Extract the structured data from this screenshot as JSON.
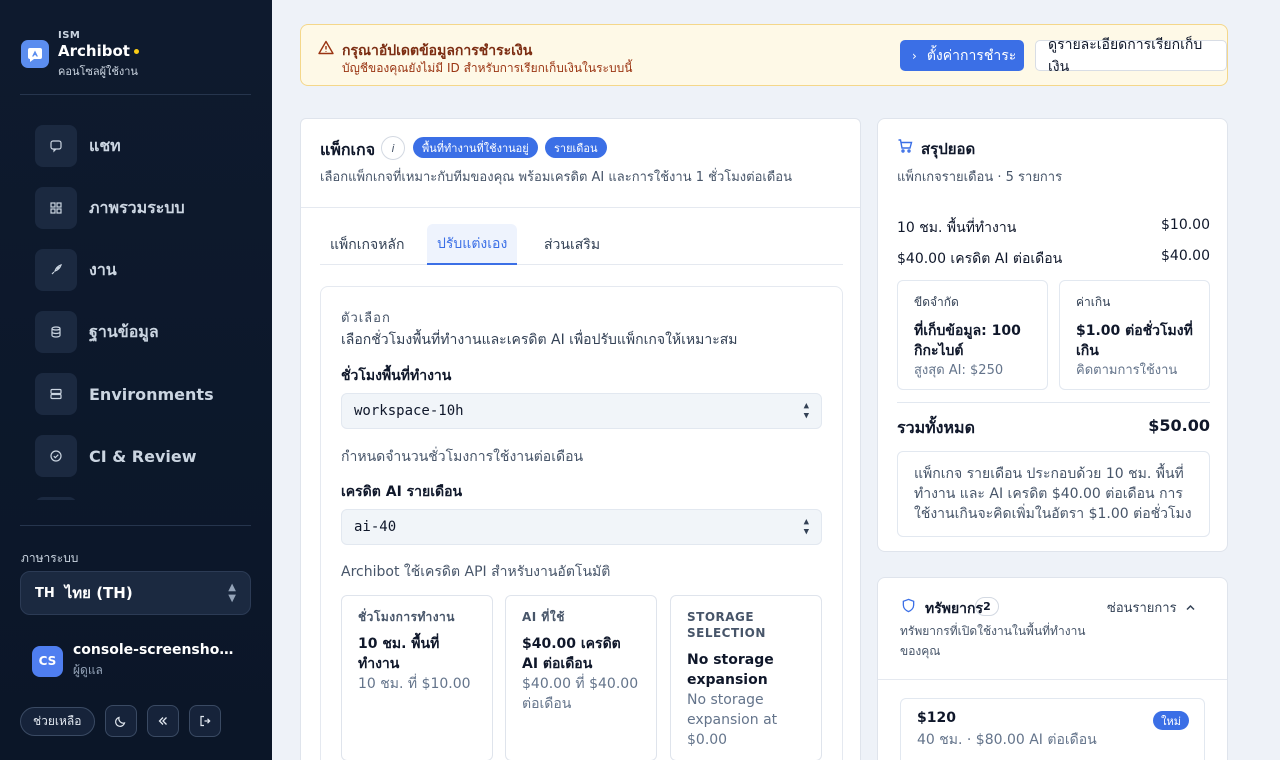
{
  "sidebar": {
    "brand_kicker": "ISM",
    "brand_name": "Archibot",
    "brand_sub": "คอนโซลผู้ใช้งาน",
    "nav": [
      {
        "label": "แชท",
        "icon": "chat-icon"
      },
      {
        "label": "ภาพรวมระบบ",
        "icon": "grid-icon"
      },
      {
        "label": "งาน",
        "icon": "rocket-icon"
      },
      {
        "label": "ฐานข้อมูล",
        "icon": "database-icon"
      },
      {
        "label": "Environments",
        "icon": "server-icon"
      },
      {
        "label": "CI & Review",
        "icon": "check-circle-icon"
      }
    ],
    "language_label": "ภาษาระบบ",
    "language_value": "ไทย (TH)",
    "language_flag": "TH",
    "user_initials": "CS",
    "user_name": "console-screenshot-admin",
    "user_role": "ผู้ดูแล",
    "help_label": "ช่วยเหลือ"
  },
  "banner": {
    "title": "กรุณาอัปเดตข้อมูลการชำระเงิน",
    "desc": "บัญชีของคุณยังไม่มี ID สำหรับการเรียกเก็บเงินในระบบนี้",
    "primary": "ตั้งค่าการชำระ",
    "secondary": "ดูรายละเอียดการเรียกเก็บเงิน"
  },
  "main": {
    "title": "แพ็กเกจ",
    "badge1": "พื้นที่ทำงานที่ใช้งานอยู่",
    "badge2": "รายเดือน",
    "desc": "เลือกแพ็กเกจที่เหมาะกับทีมของคุณ พร้อมเครดิต AI และการใช้งาน 1 ชั่วโมงต่อเดือน",
    "tabs": [
      "แพ็กเกจหลัก",
      "ปรับแต่งเอง",
      "ส่วนเสริม"
    ],
    "kicker": "ตัวเลือก",
    "inner_desc": "เลือกชั่วโมงพื้นที่ทำงานและเครดิต AI เพื่อปรับแพ็กเกจให้เหมาะสม",
    "workspace_label": "ชั่วโมงพื้นที่ทำงาน",
    "workspace_value": "workspace-10h",
    "workspace_help": "กำหนดจำนวนชั่วโมงการใช้งานต่อเดือน",
    "ai_label": "เครดิต AI รายเดือน",
    "ai_value": "ai-40",
    "ai_help": "Archibot ใช้เครดิต API สำหรับงานอัตโนมัติ",
    "cards": [
      {
        "kicker": "ชั่วโมงการทำงาน",
        "title": "10 ชม. พื้นที่ทำงาน",
        "sub": "10 ชม. ที่ $10.00"
      },
      {
        "kicker": "AI ที่ใช้",
        "title": "$40.00 เครดิต AI ต่อเดือน",
        "sub": "$40.00 ที่ $40.00 ต่อเดือน"
      },
      {
        "kicker": "STORAGE SELECTION",
        "title": "No storage expansion",
        "sub": "No storage expansion at $0.00"
      }
    ]
  },
  "order": {
    "title": "สรุปยอด",
    "sub": "แพ็กเกจรายเดือน · 5 รายการ",
    "rows": [
      {
        "label": "10 ชม. พื้นที่ทำงาน",
        "value": "$10.00"
      },
      {
        "label": "$40.00 เครดิต AI ต่อเดือน",
        "value": "$40.00"
      }
    ],
    "box1": {
      "k": "ขีดจำกัด",
      "v": "ที่เก็บข้อมูล: 100 กิกะไบต์",
      "s": "สูงสุด AI: $250"
    },
    "box2": {
      "k": "ค่าเกิน",
      "v": "$1.00 ต่อชั่วโมงที่เกิน",
      "s": "คิดตามการใช้งาน"
    },
    "total_label": "รวมทั้งหมด",
    "total_value": "$50.00",
    "note": "แพ็กเกจ รายเดือน ประกอบด้วย 10 ชม. พื้นที่ทำงาน และ AI เครดิต $40.00 ต่อเดือน การใช้งานเกินจะคิดเพิ่มในอัตรา $1.00 ต่อชั่วโมง"
  },
  "resources": {
    "title": "ทรัพยากร",
    "count": "2",
    "toggle": "ซ่อนรายการ",
    "desc": "ทรัพยากรที่เปิดใช้งานในพื้นที่ทำงานของคุณ",
    "item_price": "$120",
    "item_info": "40 ชม. · $80.00 AI ต่อเดือน",
    "item_tag": "ใหม่"
  }
}
